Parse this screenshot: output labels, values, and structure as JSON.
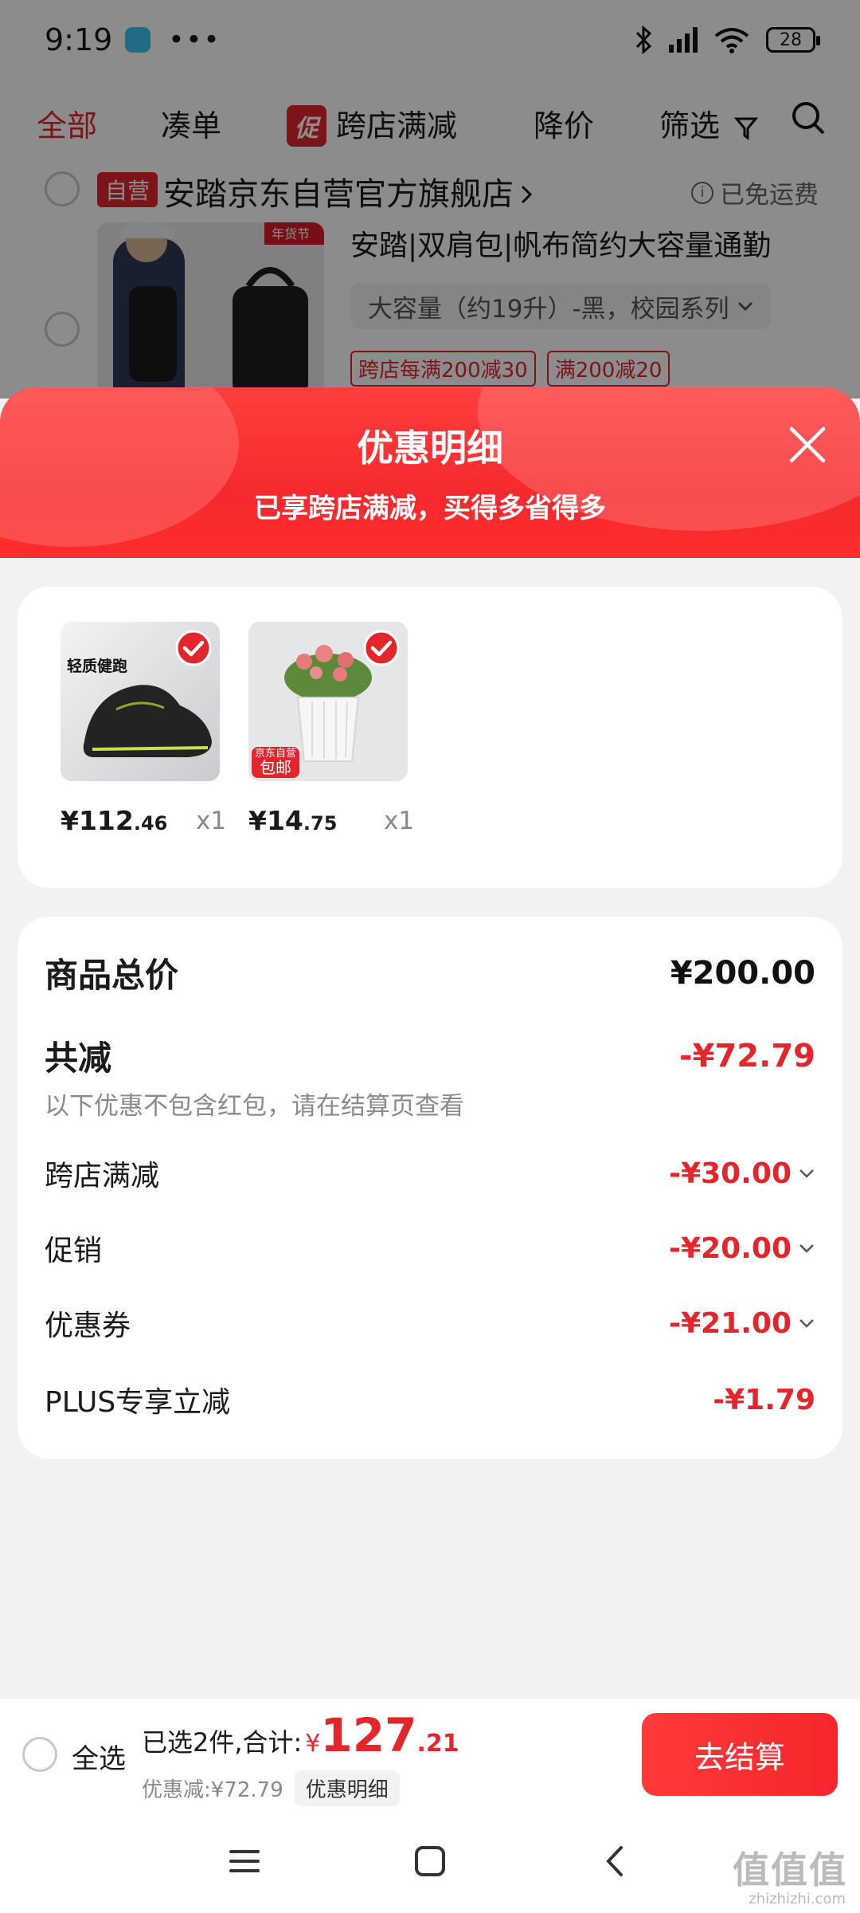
{
  "status_bar": {
    "time": "9:19",
    "dots": "•••",
    "battery": "28"
  },
  "tabs": [
    {
      "label": "全部"
    },
    {
      "label": "凑单"
    },
    {
      "label": "跨店满减",
      "badge": "促"
    },
    {
      "label": "降价"
    },
    {
      "label": "筛选"
    }
  ],
  "shop": {
    "tag": "自营",
    "name": "安踏京东自营官方旗舰店",
    "shipping": "已免运费",
    "product": {
      "title": "安踏|双肩包|帆布简约大容量通勤",
      "variant": "大容量（约19升）-黑，校园系列",
      "promos": [
        "跨店每满200减30",
        "满200减20"
      ],
      "image_badge": "年货节"
    }
  },
  "sheet": {
    "title": "优惠明细",
    "subtitle": "已享跨店满减，买得多省得多",
    "items": [
      {
        "price_int": "¥112",
        "price_dec": ".46",
        "qty": "x1",
        "image_text": "轻质健跑"
      },
      {
        "price_int": "¥14",
        "price_dec": ".75",
        "qty": "x1",
        "tag_small": "京东自营",
        "tag_big": "包邮"
      }
    ],
    "summary": {
      "total_label": "商品总价",
      "total_value": "¥200.00",
      "discount_label": "共减",
      "discount_value": "-¥72.79",
      "note": "以下优惠不包含红包，请在结算页查看",
      "lines": [
        {
          "label": "跨店满减",
          "value": "-¥30.00"
        },
        {
          "label": "促销",
          "value": "-¥20.00"
        },
        {
          "label": "优惠券",
          "value": "-¥21.00"
        },
        {
          "label": "PLUS专享立减",
          "value": "-¥1.79"
        }
      ]
    }
  },
  "bottom_bar": {
    "select_all": "全选",
    "selected_text": "已选2件,合计:",
    "currency": "¥",
    "total_int": "127",
    "total_dec": ".21",
    "saved_text": "优惠减:¥72.79",
    "detail_chip": "优惠明细",
    "checkout": "去结算"
  },
  "watermark": {
    "main": "值值值",
    "sub": "zhizhizhi.com"
  },
  "colors": {
    "accent": "#e4252b",
    "sheet_gradient_start": "#ff3e3e",
    "sheet_gradient_end": "#f52a2e"
  }
}
